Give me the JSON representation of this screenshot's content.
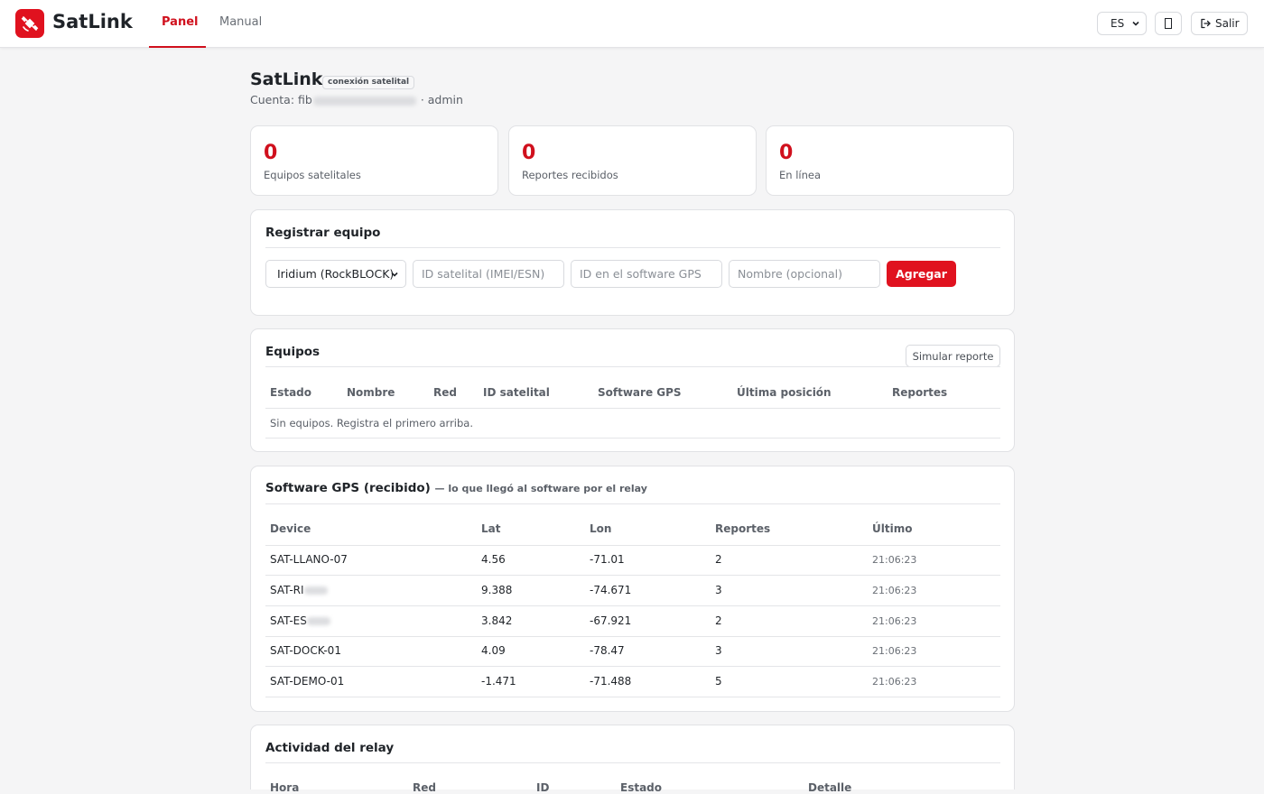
{
  "app": {
    "brand": "SatLink",
    "tabs": [
      {
        "label": "Panel",
        "active": true
      },
      {
        "label": "Manual",
        "active": false
      }
    ],
    "language": "ES",
    "logout_label": "Salir",
    "accent_color": "#e0121f"
  },
  "header": {
    "title": "SatLink",
    "badge": "conexión satelital",
    "account_prefix": "Cuenta: fib",
    "account_role": "· admin"
  },
  "stats": [
    {
      "value": "0",
      "label": "Equipos satelitales"
    },
    {
      "value": "0",
      "label": "Reportes recibidos"
    },
    {
      "value": "0",
      "label": "En línea"
    }
  ],
  "register": {
    "title": "Registrar equipo",
    "network_selected": "Iridium (RockBLOCK)",
    "sat_id_placeholder": "ID satelital (IMEI/ESN)",
    "gps_id_placeholder": "ID en el software GPS",
    "name_placeholder": "Nombre (opcional)",
    "add_label": "Agregar"
  },
  "devices": {
    "title": "Equipos",
    "simulate_label": "Simular reporte",
    "columns": [
      "Estado",
      "Nombre",
      "Red",
      "ID satelital",
      "Software GPS",
      "Última posición",
      "Reportes"
    ],
    "empty_message": "Sin equipos. Registra el primero arriba."
  },
  "gps_received": {
    "title": "Software GPS (recibido)",
    "subtitle": "— lo que llegó al software por el relay",
    "columns": [
      "Device",
      "Lat",
      "Lon",
      "Reportes",
      "Último"
    ],
    "rows": [
      {
        "device": "SAT-LLANO-07",
        "lat": "4.56",
        "lon": "-71.01",
        "reports": "2",
        "last": "21:06:23"
      },
      {
        "device": "SAT-RI",
        "lat": "9.388",
        "lon": "-74.671",
        "reports": "3",
        "last": "21:06:23"
      },
      {
        "device": "SAT-ES",
        "lat": "3.842",
        "lon": "-67.921",
        "reports": "2",
        "last": "21:06:23"
      },
      {
        "device": "SAT-DOCK-01",
        "lat": "4.09",
        "lon": "-78.47",
        "reports": "3",
        "last": "21:06:23"
      },
      {
        "device": "SAT-DEMO-01",
        "lat": "-1.471",
        "lon": "-71.488",
        "reports": "5",
        "last": "21:06:23"
      }
    ]
  },
  "relay_activity": {
    "title": "Actividad del relay",
    "columns": [
      "Hora",
      "Red",
      "ID",
      "Estado",
      "Detalle"
    ]
  }
}
